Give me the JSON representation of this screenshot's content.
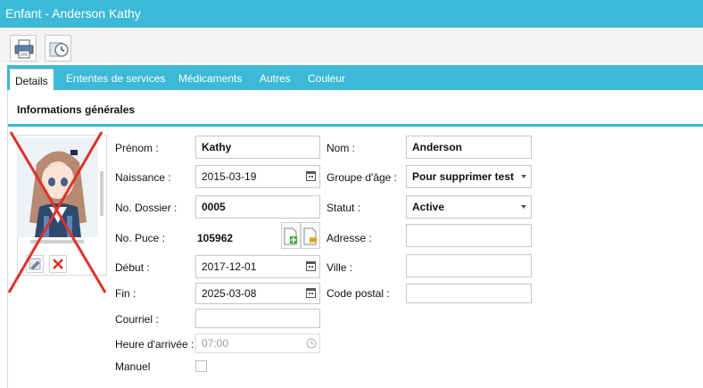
{
  "window": {
    "title": "Enfant - Anderson Kathy"
  },
  "toolbar": {
    "print_icon": "printer-icon",
    "history_icon": "clock-history-icon"
  },
  "tabs": [
    {
      "label": "Details",
      "active": true
    },
    {
      "label": "Ententes de services",
      "active": false
    },
    {
      "label": "Médicaments",
      "active": false
    },
    {
      "label": "Autres",
      "active": false
    },
    {
      "label": "Couleur",
      "active": false
    }
  ],
  "section": {
    "title": "Informations générales"
  },
  "photo": {
    "edit_icon": "pencil-icon",
    "delete_icon": "delete-x-icon",
    "crossed_out": true
  },
  "form": {
    "prenom": {
      "label": "Prénom :",
      "value": "Kathy"
    },
    "nom": {
      "label": "Nom :",
      "value": "Anderson"
    },
    "naissance": {
      "label": "Naissance :",
      "value": "2015-03-19"
    },
    "groupe_age": {
      "label": "Groupe d'âge :",
      "value": "Pour supprimer test"
    },
    "dossier": {
      "label": "No. Dossier :",
      "value": "0005"
    },
    "statut": {
      "label": "Statut :",
      "value": "Active"
    },
    "puce": {
      "label": "No. Puce :",
      "value": "105962"
    },
    "adresse": {
      "label": "Adresse :",
      "value": ""
    },
    "debut": {
      "label": "Début :",
      "value": "2017-12-01"
    },
    "ville": {
      "label": "Ville :",
      "value": ""
    },
    "fin": {
      "label": "Fin :",
      "value": "2025-03-08"
    },
    "code_postal": {
      "label": "Code postal :",
      "value": ""
    },
    "courriel": {
      "label": "Courriel :",
      "value": ""
    },
    "heure_arrivee": {
      "label": "Heure d'arrivée :",
      "value": "07:00"
    },
    "manuel": {
      "label": "Manuel",
      "checked": false
    }
  },
  "colors": {
    "accent": "#3bb9d6",
    "cross": "#e0312b"
  }
}
